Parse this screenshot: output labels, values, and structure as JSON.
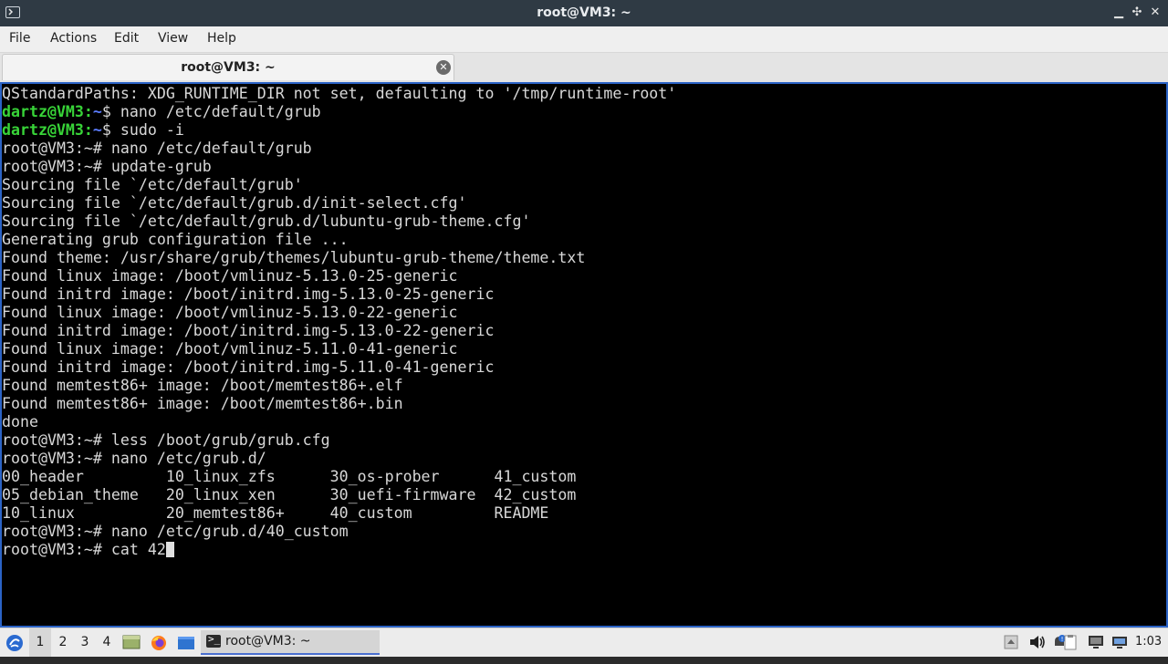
{
  "window": {
    "title": "root@VM3: ~",
    "minimize_glyph": "▁",
    "maximize_glyph": "✣",
    "close_glyph": "✕"
  },
  "menu": [
    "File",
    "Actions",
    "Edit",
    "View",
    "Help"
  ],
  "tab": {
    "label": "root@VM3: ~"
  },
  "terminal": {
    "lines": [
      [
        {
          "t": "QStandardPaths: XDG_RUNTIME_DIR not set, defaulting to '/tmp/runtime-root'"
        }
      ],
      [
        {
          "t": "dartz@VM3:",
          "c": "green"
        },
        {
          "t": "~",
          "c": "blue"
        },
        {
          "t": "$ nano /etc/default/grub"
        }
      ],
      [
        {
          "t": "dartz@VM3:",
          "c": "green"
        },
        {
          "t": "~",
          "c": "blue"
        },
        {
          "t": "$ sudo -i"
        }
      ],
      [
        {
          "t": "root@VM3:~# nano /etc/default/grub"
        }
      ],
      [
        {
          "t": "root@VM3:~# update-grub"
        }
      ],
      [
        {
          "t": "Sourcing file `/etc/default/grub'"
        }
      ],
      [
        {
          "t": "Sourcing file `/etc/default/grub.d/init-select.cfg'"
        }
      ],
      [
        {
          "t": "Sourcing file `/etc/default/grub.d/lubuntu-grub-theme.cfg'"
        }
      ],
      [
        {
          "t": "Generating grub configuration file ..."
        }
      ],
      [
        {
          "t": "Found theme: /usr/share/grub/themes/lubuntu-grub-theme/theme.txt"
        }
      ],
      [
        {
          "t": "Found linux image: /boot/vmlinuz-5.13.0-25-generic"
        }
      ],
      [
        {
          "t": "Found initrd image: /boot/initrd.img-5.13.0-25-generic"
        }
      ],
      [
        {
          "t": "Found linux image: /boot/vmlinuz-5.13.0-22-generic"
        }
      ],
      [
        {
          "t": "Found initrd image: /boot/initrd.img-5.13.0-22-generic"
        }
      ],
      [
        {
          "t": "Found linux image: /boot/vmlinuz-5.11.0-41-generic"
        }
      ],
      [
        {
          "t": "Found initrd image: /boot/initrd.img-5.11.0-41-generic"
        }
      ],
      [
        {
          "t": "Found memtest86+ image: /boot/memtest86+.elf"
        }
      ],
      [
        {
          "t": "Found memtest86+ image: /boot/memtest86+.bin"
        }
      ],
      [
        {
          "t": "done"
        }
      ],
      [
        {
          "t": "root@VM3:~# less /boot/grub/grub.cfg"
        }
      ],
      [
        {
          "t": "root@VM3:~# nano /etc/grub.d/"
        }
      ],
      [
        {
          "t": "00_header         10_linux_zfs      30_os-prober      41_custom"
        }
      ],
      [
        {
          "t": "05_debian_theme   20_linux_xen      30_uefi-firmware  42_custom"
        }
      ],
      [
        {
          "t": "10_linux          20_memtest86+     40_custom         README"
        }
      ],
      [
        {
          "t": "root@VM3:~# nano /etc/grub.d/40_custom"
        }
      ],
      [
        {
          "t": "root@VM3:~# cat 42"
        },
        {
          "cursor": true
        }
      ]
    ]
  },
  "taskbar": {
    "workspaces": [
      "1",
      "2",
      "3",
      "4"
    ],
    "active_workspace": "1",
    "task_label": "root@VM3: ~",
    "clock": "1:03",
    "colors": {
      "accent": "#4a6fd0",
      "prompt_green": "#38d438",
      "prompt_blue": "#5b7cff"
    }
  }
}
